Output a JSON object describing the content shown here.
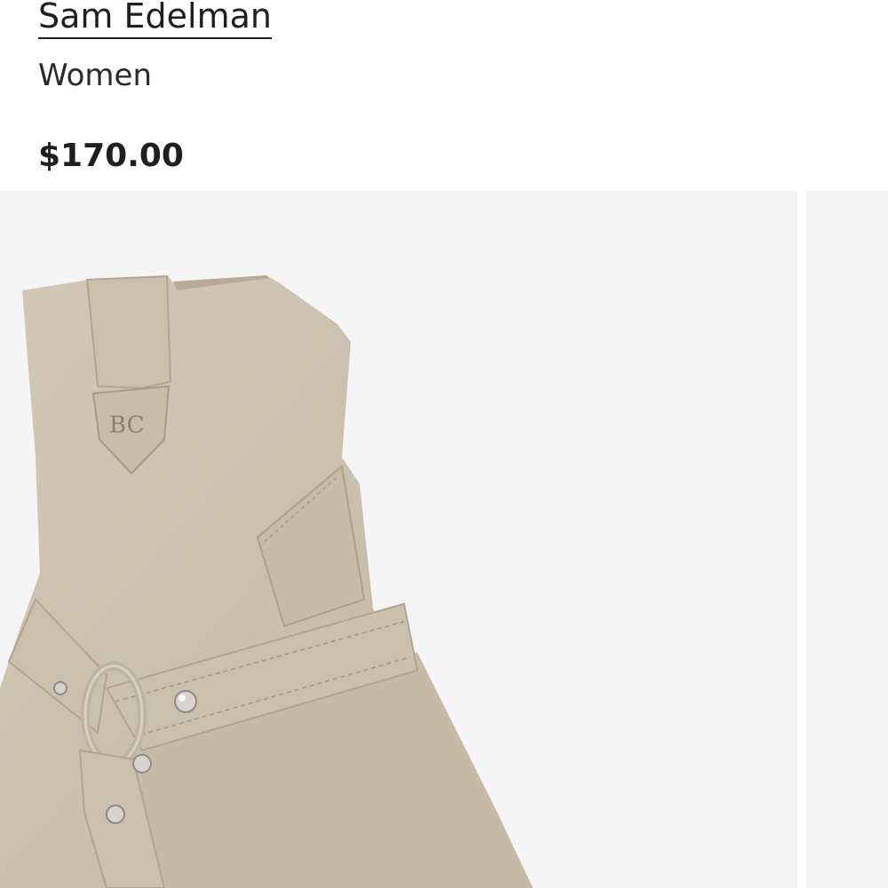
{
  "product": {
    "brand": "Sam Edelman",
    "category": "Women",
    "price": "$170.00"
  },
  "gallery": {
    "slides": [
      {
        "name": "product-image-1",
        "alt": "Sam Edelman suede western harness ankle boot"
      },
      {
        "name": "product-image-2",
        "alt": ""
      }
    ],
    "colors": {
      "background": "#f5f5f5",
      "suede": "#cfc3b2",
      "suede_shadow": "#b9ab98",
      "heel": "#9c6c45"
    }
  }
}
